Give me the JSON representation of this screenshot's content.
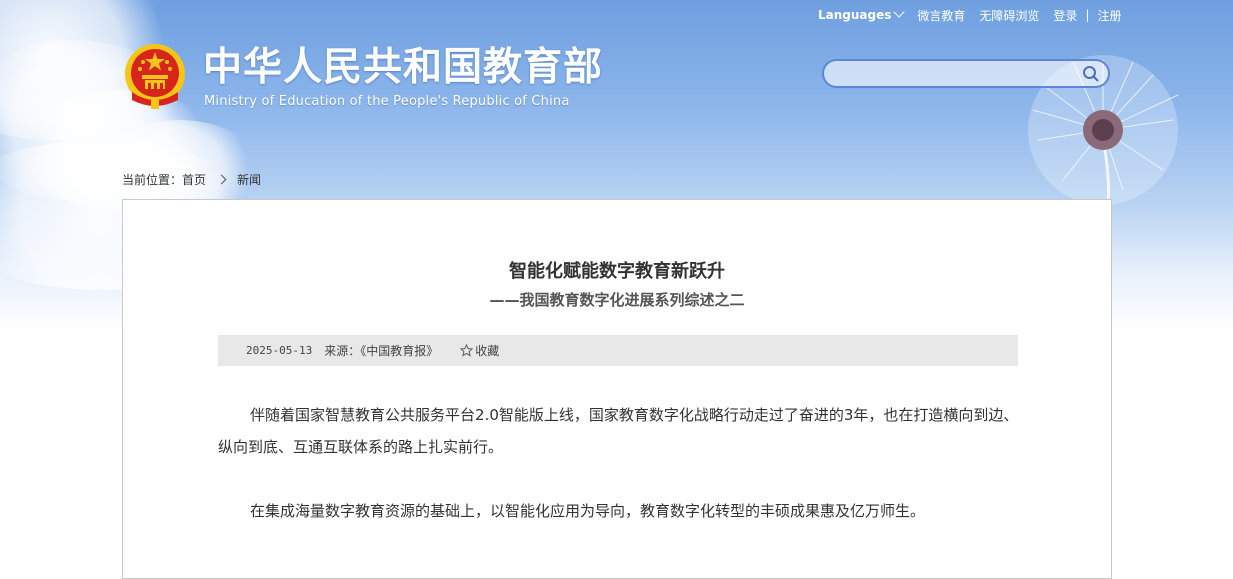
{
  "header": {
    "languages_label": "Languages",
    "top_links": [
      "微言教育",
      "无障碍浏览",
      "登录"
    ],
    "top_separator": "|",
    "register_label": "注册",
    "site_title": "中华人民共和国教育部",
    "site_subtitle": "Ministry of Education of the People's Republic of China",
    "search_placeholder": ""
  },
  "breadcrumb": {
    "label": "当前位置：",
    "home": "首页",
    "current": "新闻"
  },
  "article": {
    "title": "智能化赋能数字教育新跃升",
    "subtitle": "——我国教育数字化进展系列综述之二",
    "date": "2025-05-13",
    "source": "来源：《中国教育报》",
    "favorite_label": "收藏",
    "paragraphs": [
      "伴随着国家智慧教育公共服务平台2.0智能版上线，国家教育数字化战略行动走过了奋进的3年，也在打造横向到边、纵向到底、互通互联体系的路上扎实前行。",
      "在集成海量数字教育资源的基础上，以智能化应用为导向，教育数字化转型的丰硕成果惠及亿万师生。"
    ]
  },
  "colors": {
    "emblem_red": "#d8251c",
    "emblem_gold": "#f5c518",
    "search_border": "#5f86d6",
    "meta_bg": "#e8e8e8"
  }
}
